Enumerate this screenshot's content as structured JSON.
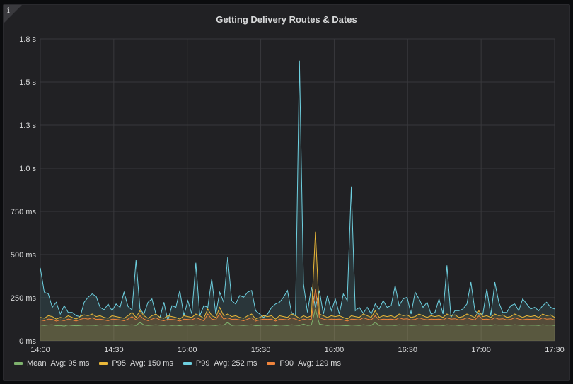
{
  "panel": {
    "title": "Getting Delivery Routes & Dates",
    "info_icon": "info-icon"
  },
  "chart_data": {
    "type": "line",
    "title": "Getting Delivery Routes & Dates",
    "xlabel": "",
    "ylabel": "",
    "x_range": [
      "14:00",
      "17:30"
    ],
    "ylim_ms": [
      0,
      1800
    ],
    "y_ticks": [
      "0 ms",
      "250 ms",
      "500 ms",
      "750 ms",
      "1.0 s",
      "1.3 s",
      "1.5 s",
      "1.8 s"
    ],
    "x_ticks": [
      "14:00",
      "14:30",
      "15:00",
      "15:30",
      "16:00",
      "16:30",
      "17:00",
      "17:30"
    ],
    "grid": true,
    "legend_placement": "bottom-left",
    "series": [
      {
        "name": "Mean",
        "avg_label": "Avg: 95 ms",
        "color": "#7eb26d",
        "values": [
          95,
          92,
          95,
          96,
          90,
          92,
          88,
          95,
          92,
          90,
          92,
          95,
          93,
          94,
          92,
          96,
          94,
          92,
          95,
          90,
          93,
          92,
          94,
          96,
          92,
          110,
          95,
          92,
          94,
          96,
          93,
          92,
          95,
          92,
          94,
          90,
          95,
          93,
          92,
          96,
          94,
          92,
          95,
          93,
          92,
          96,
          94,
          110,
          92,
          95,
          93,
          92,
          94,
          96,
          90,
          92,
          95,
          93,
          94,
          90,
          95,
          93,
          92,
          96,
          94,
          92,
          100,
          92,
          95,
          190,
          100,
          96,
          92,
          95,
          93,
          94,
          92,
          90,
          95,
          93,
          92,
          96,
          94,
          92,
          110,
          92,
          95,
          93,
          94,
          92,
          96,
          94,
          95,
          92,
          93,
          96,
          94,
          92,
          95,
          93,
          94,
          92,
          96,
          94,
          95,
          92,
          93,
          96,
          94,
          92,
          95,
          93,
          94,
          92,
          96,
          94,
          95,
          92,
          93,
          96,
          94,
          92,
          95,
          93,
          94,
          92,
          96,
          94,
          95,
          92
        ]
      },
      {
        "name": "P95",
        "avg_label": "Avg: 150 ms",
        "color": "#eab839",
        "values": [
          140,
          135,
          150,
          145,
          130,
          140,
          135,
          150,
          140,
          130,
          145,
          155,
          150,
          160,
          145,
          150,
          140,
          135,
          150,
          145,
          140,
          135,
          150,
          170,
          140,
          180,
          150,
          135,
          150,
          160,
          140,
          135,
          150,
          145,
          140,
          130,
          150,
          145,
          140,
          160,
          150,
          135,
          190,
          150,
          140,
          200,
          150,
          160,
          145,
          150,
          140,
          135,
          150,
          160,
          130,
          140,
          150,
          145,
          150,
          130,
          150,
          145,
          140,
          160,
          150,
          135,
          150,
          140,
          150,
          650,
          160,
          150,
          140,
          150,
          145,
          150,
          140,
          130,
          150,
          145,
          140,
          160,
          150,
          140,
          180,
          140,
          150,
          145,
          150,
          140,
          160,
          150,
          155,
          140,
          145,
          160,
          150,
          140,
          150,
          145,
          150,
          140,
          160,
          150,
          155,
          140,
          145,
          160,
          150,
          140,
          180,
          145,
          150,
          140,
          160,
          150,
          155,
          140,
          145,
          160,
          150,
          140,
          150,
          145,
          150,
          140,
          160,
          150,
          155,
          140
        ]
      },
      {
        "name": "P99",
        "avg_label": "Avg: 252 ms",
        "color": "#6ed0e0",
        "values": [
          435,
          290,
          280,
          200,
          230,
          160,
          210,
          170,
          170,
          150,
          145,
          230,
          260,
          280,
          265,
          200,
          185,
          220,
          180,
          220,
          200,
          290,
          205,
          185,
          480,
          190,
          160,
          230,
          250,
          160,
          140,
          230,
          120,
          210,
          200,
          300,
          150,
          240,
          160,
          465,
          150,
          210,
          200,
          370,
          160,
          290,
          230,
          500,
          240,
          220,
          270,
          260,
          290,
          300,
          180,
          160,
          140,
          160,
          200,
          220,
          230,
          260,
          300,
          170,
          150,
          1670,
          340,
          170,
          320,
          200,
          300,
          160,
          270,
          180,
          250,
          160,
          280,
          240,
          920,
          180,
          200,
          165,
          200,
          160,
          220,
          190,
          240,
          200,
          210,
          330,
          210,
          250,
          260,
          160,
          290,
          250,
          200,
          230,
          160,
          170,
          250,
          160,
          450,
          140,
          180,
          180,
          190,
          220,
          350,
          180,
          160,
          160,
          310,
          150,
          350,
          230,
          170,
          170,
          210,
          220,
          180,
          250,
          220,
          190,
          200,
          180,
          210,
          230,
          200,
          190
        ]
      },
      {
        "name": "P90",
        "avg_label": "Avg: 129 ms",
        "color": "#ef843c",
        "values": [
          125,
          120,
          130,
          128,
          118,
          125,
          120,
          130,
          125,
          118,
          128,
          135,
          130,
          138,
          128,
          130,
          125,
          120,
          130,
          128,
          125,
          120,
          130,
          145,
          125,
          150,
          130,
          120,
          130,
          138,
          125,
          120,
          130,
          128,
          125,
          118,
          130,
          128,
          125,
          138,
          130,
          120,
          160,
          130,
          125,
          165,
          130,
          138,
          128,
          130,
          125,
          120,
          130,
          138,
          118,
          125,
          130,
          128,
          130,
          118,
          130,
          128,
          125,
          138,
          130,
          120,
          130,
          125,
          130,
          310,
          138,
          130,
          125,
          130,
          128,
          130,
          125,
          118,
          130,
          128,
          125,
          138,
          130,
          125,
          150,
          125,
          130,
          128,
          130,
          125,
          138,
          130,
          132,
          125,
          128,
          138,
          130,
          125,
          130,
          128,
          130,
          125,
          138,
          130,
          132,
          125,
          128,
          138,
          130,
          125,
          150,
          128,
          130,
          125,
          138,
          130,
          132,
          125,
          128,
          138,
          130,
          125,
          130,
          128,
          130,
          125,
          138,
          130,
          132,
          125
        ]
      }
    ]
  }
}
